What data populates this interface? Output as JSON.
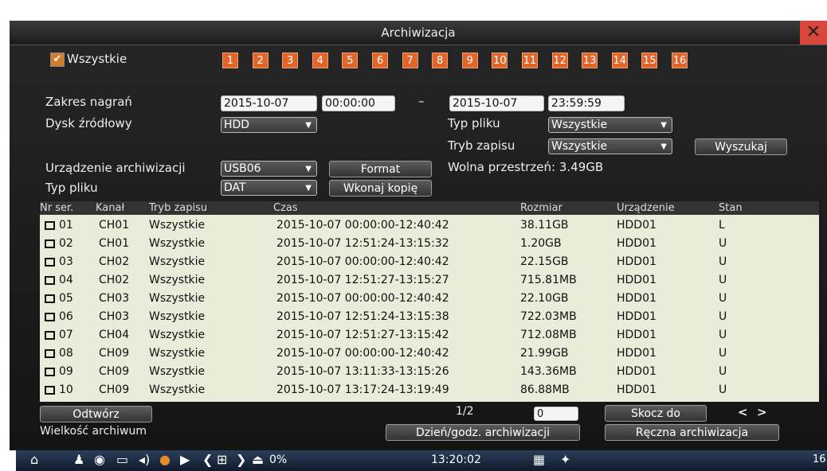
{
  "window": {
    "title": "Archiwizacja",
    "close": "✕"
  },
  "channels": {
    "all_label": "Wszystkie",
    "numbers": [
      "1",
      "2",
      "3",
      "4",
      "5",
      "6",
      "7",
      "8",
      "9",
      "10",
      "11",
      "12",
      "13",
      "14",
      "15",
      "16"
    ]
  },
  "form": {
    "range_label": "Zakres nagrań",
    "start_date": "2015-10-07",
    "start_time": "00:00:00",
    "dash": "–",
    "end_date": "2015-10-07",
    "end_time": "23:59:59",
    "source_disk_label": "Dysk źródłowy",
    "source_disk": "HDD",
    "file_type_label": "Typ pliku",
    "file_type": "Wszystkie",
    "record_mode_label": "Tryb zapisu",
    "record_mode": "Wszystkie",
    "search_button": "Wyszukaj",
    "device_label": "Urządzenie archiwizacji",
    "device": "USB06",
    "format_button": "Format",
    "free_space": "Wolna przestrzeń: 3.49GB",
    "out_type_label": "Typ pliku",
    "out_type": "DAT",
    "copy_button": "Wkonaj kopię"
  },
  "table": {
    "headers": [
      "Nr ser.",
      "Kanał",
      "Tryb zapisu",
      "Czas",
      "Rozmiar",
      "Urządzenie",
      "Stan"
    ],
    "rows": [
      [
        "01",
        "CH01",
        "Wszystkie",
        "2015-10-07 00:00:00-12:40:42",
        "38.11GB",
        "HDD01",
        "L"
      ],
      [
        "02",
        "CH01",
        "Wszystkie",
        "2015-10-07 12:51:24-13:15:32",
        "1.20GB",
        "HDD01",
        "U"
      ],
      [
        "03",
        "CH02",
        "Wszystkie",
        "2015-10-07 00:00:00-12:40:42",
        "22.15GB",
        "HDD01",
        "U"
      ],
      [
        "04",
        "CH02",
        "Wszystkie",
        "2015-10-07 12:51:27-13:15:27",
        "715.81MB",
        "HDD01",
        "U"
      ],
      [
        "05",
        "CH03",
        "Wszystkie",
        "2015-10-07 00:00:00-12:40:42",
        "22.10GB",
        "HDD01",
        "U"
      ],
      [
        "06",
        "CH03",
        "Wszystkie",
        "2015-10-07 12:51:24-13:15:38",
        "722.03MB",
        "HDD01",
        "U"
      ],
      [
        "07",
        "CH04",
        "Wszystkie",
        "2015-10-07 12:51:27-13:15:42",
        "712.08MB",
        "HDD01",
        "U"
      ],
      [
        "08",
        "CH09",
        "Wszystkie",
        "2015-10-07 00:00:00-12:40:42",
        "21.99GB",
        "HDD01",
        "U"
      ],
      [
        "09",
        "CH09",
        "Wszystkie",
        "2015-10-07 13:11:33-13:15:26",
        "143.36MB",
        "HDD01",
        "U"
      ],
      [
        "10",
        "CH09",
        "Wszystkie",
        "2015-10-07 13:17:24-13:19:49",
        "86.88MB",
        "HDD01",
        "U"
      ]
    ]
  },
  "footer": {
    "play_button": "Odtwórz",
    "page": "1/2",
    "page_input": "0",
    "jump_button": "Skocz do",
    "prev": "<",
    "next": ">",
    "archive_size_label": "Wielkość archiwum",
    "date_archive_button": "Dzień/godz. archiwizacji",
    "manual_archive_button": "Ręczna archiwizacja"
  },
  "taskbar": {
    "percent": "0%",
    "time": "13:20:02",
    "corner": "16"
  },
  "colors": {
    "channel": "#e0662c",
    "table_bg": "#e8ecd8"
  }
}
